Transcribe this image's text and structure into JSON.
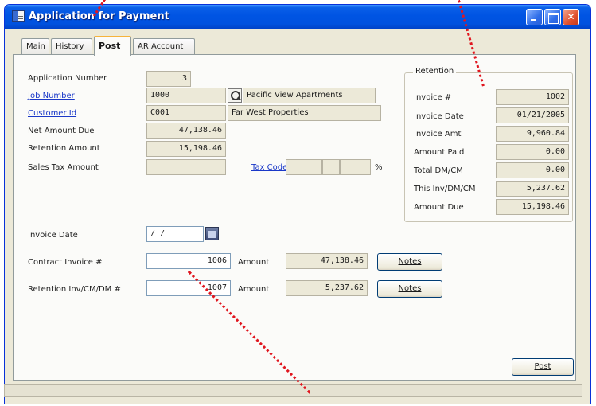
{
  "window": {
    "title": "Application for Payment",
    "buttons": {
      "minimize": "_",
      "maximize": "□",
      "close": "✕"
    }
  },
  "tabs": [
    {
      "label": "Main"
    },
    {
      "label": "History"
    },
    {
      "label": "Post"
    },
    {
      "label": "AR Account"
    }
  ],
  "active_tab": "Post",
  "form": {
    "application_number": {
      "label": "Application Number",
      "value": "3"
    },
    "job_number": {
      "label": "Job Number",
      "value": "1000",
      "description": "Pacific View Apartments"
    },
    "customer_id": {
      "label": "Customer Id",
      "value": "C001",
      "description": "Far West Properties"
    },
    "net_amount_due": {
      "label": "Net Amount Due",
      "value": "47,138.46"
    },
    "retention_amount": {
      "label": "Retention Amount",
      "value": "15,198.46"
    },
    "sales_tax_amount": {
      "label": "Sales Tax Amount",
      "value": ""
    },
    "tax_code": {
      "label": "Tax Code",
      "value1": "",
      "value2": "",
      "value3": "",
      "suffix": "%"
    },
    "invoice_date": {
      "label": "Invoice Date",
      "value": "/ /"
    },
    "contract_invoice": {
      "label": "Contract Invoice #",
      "value": "1006",
      "amount_label": "Amount",
      "amount": "47,138.46",
      "notes_label": "Notes"
    },
    "retention_invoice": {
      "label": "Retention Inv/CM/DM #",
      "value": "1007",
      "amount_label": "Amount",
      "amount": "5,237.62",
      "notes_label": "Notes"
    }
  },
  "retention": {
    "title": "Retention",
    "rows": [
      {
        "label": "Invoice #",
        "value": "1002"
      },
      {
        "label": "Invoice Date",
        "value": "01/21/2005"
      },
      {
        "label": "Invoice Amt",
        "value": "9,960.84"
      },
      {
        "label": "Amount Paid",
        "value": "0.00"
      },
      {
        "label": "Total DM/CM",
        "value": "0.00"
      },
      {
        "label": "This Inv/DM/CM",
        "value": "5,237.62"
      },
      {
        "label": "Amount Due",
        "value": "15,198.46"
      }
    ]
  },
  "actions": {
    "post_label": "Post"
  },
  "colors": {
    "annotation_line": "#e0161f",
    "titlebar": "#0054e3",
    "tab_highlight": "#f6b33b"
  }
}
